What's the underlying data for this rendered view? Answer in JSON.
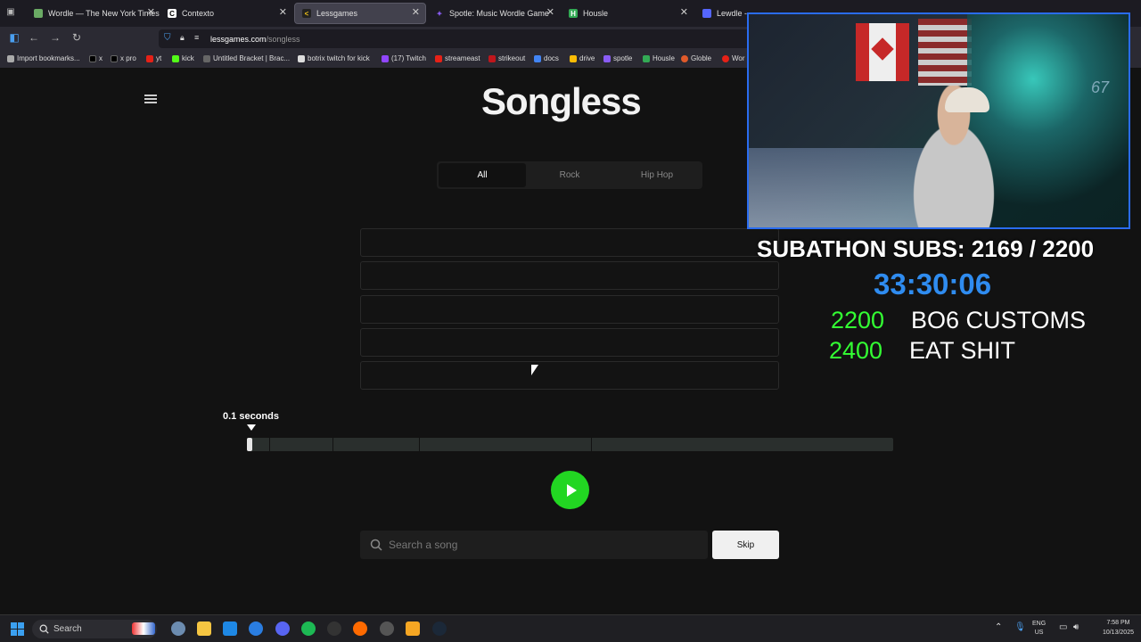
{
  "browser": {
    "tabs": [
      {
        "label": "Wordle — The New York Times",
        "favicon": "wordle-icon",
        "color": "#6aaa64"
      },
      {
        "label": "Contexto",
        "favicon": "contexto-icon",
        "color": "#ffffff"
      },
      {
        "label": "Lessgames",
        "favicon": "lessgames-icon",
        "color": "#f5c518",
        "active": true
      },
      {
        "label": "Spotle: Music Wordle Game",
        "favicon": "spotle-icon",
        "color": "#8a5cf5"
      },
      {
        "label": "Housle",
        "favicon": "housle-icon",
        "color": "#33aa55"
      },
      {
        "label": "Lewdle - T",
        "favicon": "lewdle-icon",
        "color": "#5566ff"
      }
    ],
    "url_host": "lessgames.com",
    "url_path": "/songless",
    "bookmarks": [
      "Import bookmarks...",
      "x",
      "x pro",
      "yt",
      "kick",
      "Untitled Bracket | Brac...",
      "botrix twitch for kick",
      "(17) Twitch",
      "streameast",
      "strikeout",
      "docs",
      "drive",
      "spotle",
      "Housle",
      "Globle",
      "Wor"
    ]
  },
  "page": {
    "logo": "Songless",
    "genre_tabs": [
      "All",
      "Rock",
      "Hip Hop"
    ],
    "time_label": "0.1 seconds",
    "progress_fraction": 0.004,
    "search_placeholder": "Search a song",
    "skip_label": "Skip"
  },
  "overlay": {
    "subs": "SUBATHON SUBS: 2169 / 2200",
    "timer": "33:30:06",
    "goals": [
      {
        "n": "2200",
        "t": "BO6 CUSTOMS"
      },
      {
        "n": "2400",
        "t": "EAT SHIT"
      }
    ],
    "cam_number": "67"
  },
  "taskbar": {
    "search": "Search",
    "lang_line1": "ENG",
    "lang_line2": "US",
    "time": "7:58 PM",
    "date": "10/13/2025"
  }
}
